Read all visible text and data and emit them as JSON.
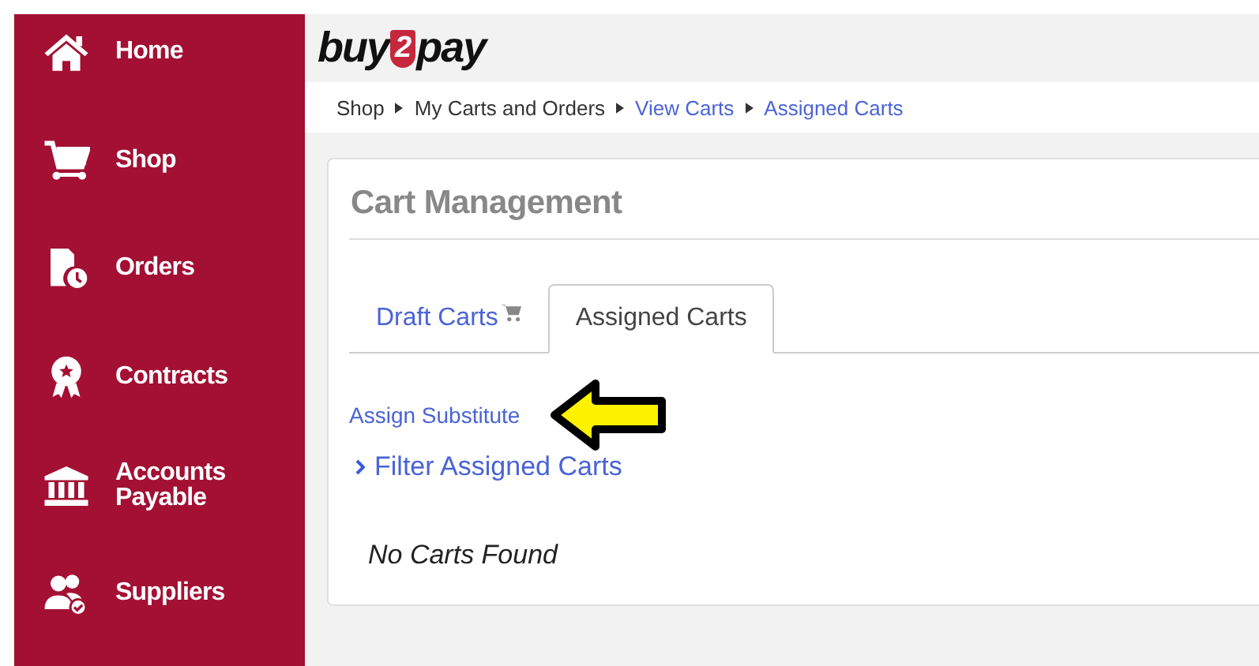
{
  "sidebar": {
    "items": [
      {
        "label": "Home"
      },
      {
        "label": "Shop"
      },
      {
        "label": "Orders"
      },
      {
        "label": "Contracts"
      },
      {
        "label": "Accounts Payable"
      },
      {
        "label": "Suppliers"
      }
    ]
  },
  "logo": {
    "before": "buy",
    "badge": "2",
    "after": "pay"
  },
  "breadcrumb": [
    {
      "label": "Shop",
      "kind": "text"
    },
    {
      "label": "My Carts and Orders",
      "kind": "text"
    },
    {
      "label": "View Carts",
      "kind": "link"
    },
    {
      "label": "Assigned Carts",
      "kind": "link"
    }
  ],
  "card": {
    "title": "Cart Management",
    "tabs": [
      {
        "label": "Draft Carts",
        "selected": false,
        "cart_icon": true
      },
      {
        "label": "Assigned Carts",
        "selected": true,
        "cart_icon": false
      }
    ],
    "assign_link": "Assign Substitute",
    "filter_link": "Filter Assigned Carts",
    "empty_message": "No Carts Found"
  }
}
